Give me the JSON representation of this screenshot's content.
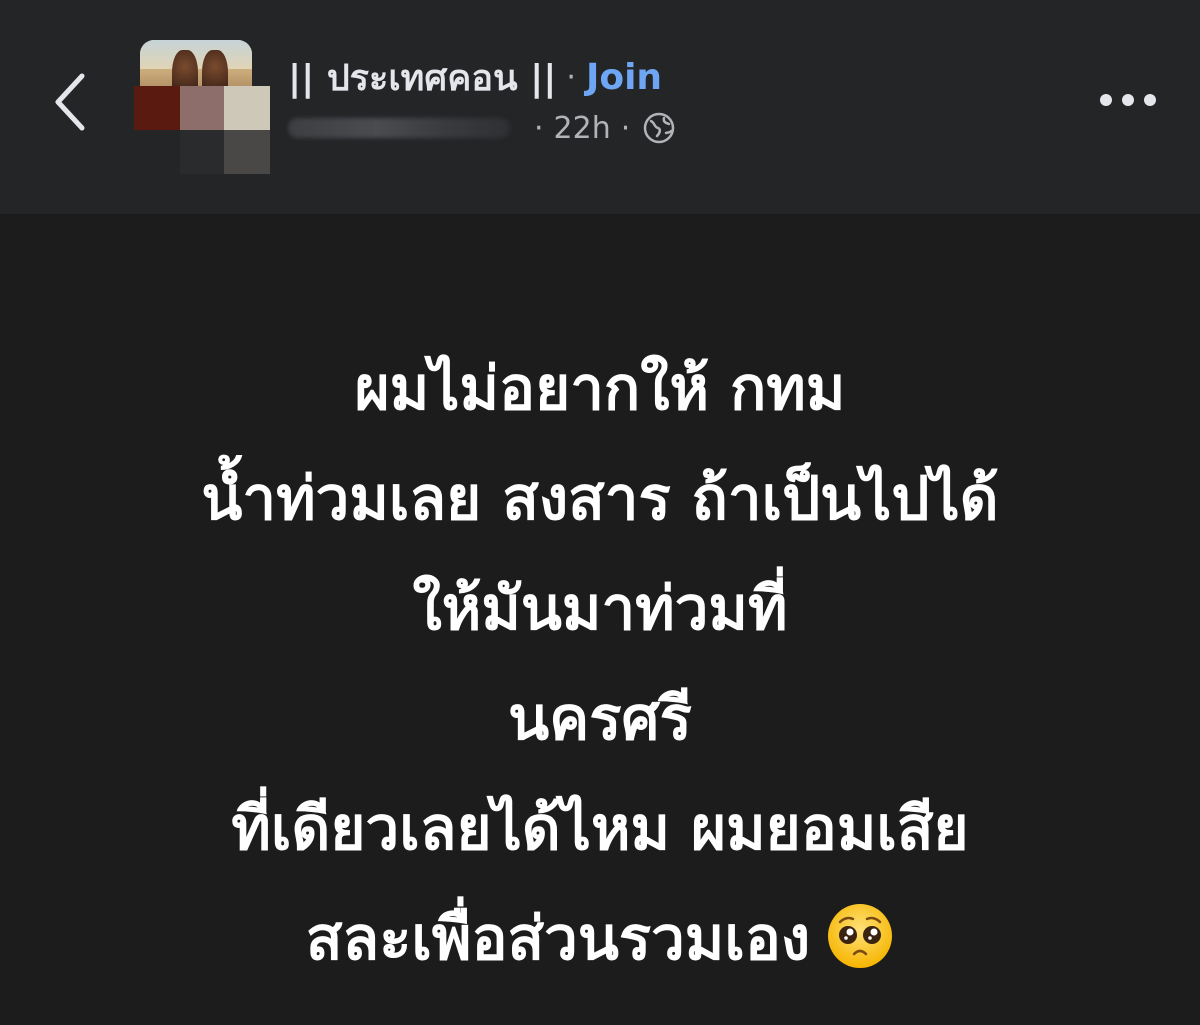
{
  "header": {
    "back_icon": "chevron-left-icon",
    "group_name": "|| ประเทศคอน ||",
    "separator": "·",
    "join_label": "Join",
    "time_ago": "22h",
    "meta_separator": "·",
    "privacy_icon": "globe-icon",
    "more_icon": "more-horizontal-icon"
  },
  "post": {
    "lines": [
      "ผมไม่อยากให้ กทม",
      "น้ำท่วมเลย สงสาร ถ้าเป็นไปได้",
      "ให้มันมาท่วมที่",
      "นครศรี",
      "ที่เดียวเลยได้ไหม ผมยอมเสีย",
      "สละเพื่อส่วนรวมเอง"
    ],
    "emoji": "pleading-face-icon"
  },
  "colors": {
    "header_bg": "#242527",
    "body_bg": "#1c1c1d",
    "accent_link": "#6ea6f3",
    "secondary_text": "#b0b3b8"
  }
}
